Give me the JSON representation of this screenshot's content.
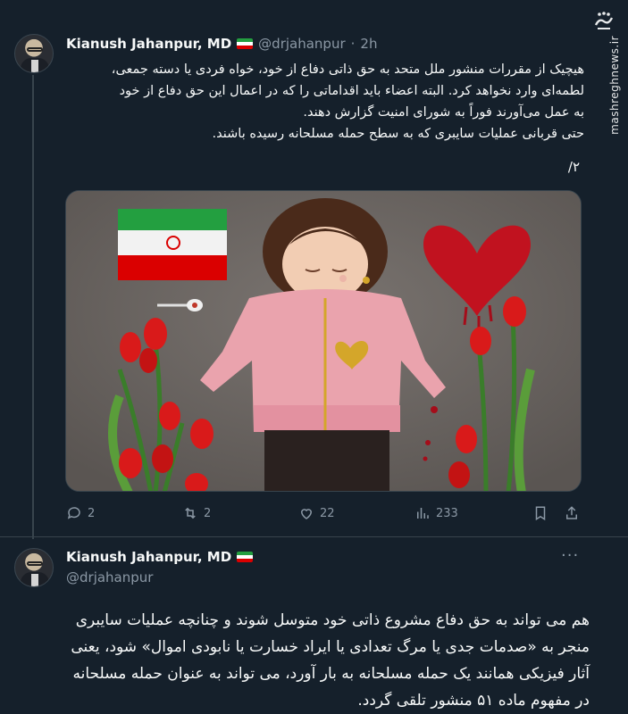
{
  "watermark": {
    "site": "mashreghnews.ir",
    "logo_name": "mashregh-logo"
  },
  "tweet1": {
    "author_name": "Kianush Jahanpur, MD",
    "handle": "@drjahanpur",
    "separator": "·",
    "time": "2h",
    "text_lines": [
      "هیچیک از مقررات منشور ملل متحد به حق ذاتی دفاع از خود، خواه فردی یا دسته جمعی،",
      "لطمه‌ای وارد نخواهد کرد. البته اعضاء باید اقداماتی را که در اعمال این حق دفاع از خود",
      "به عمل می‌آورند فوراً به شورای امنیت گزارش دهند.",
      "حتی قربانی عملیات سایبری که به سطح حمله مسلحانه رسیده باشند."
    ],
    "thread_number": "۲/",
    "stats": {
      "replies": "2",
      "reposts": "2",
      "likes": "22",
      "views": "233"
    }
  },
  "tweet2": {
    "author_name": "Kianush Jahanpur, MD",
    "handle": "@drjahanpur",
    "more_label": "···",
    "text_lines": [
      "هم می تواند به حق دفاع مشروع ذاتی خود متوسل شوند و چنانچه عملیات سایبری",
      "منجر به «صدمات جدی یا مرگ تعدادی یا ایراد خسارت یا نابودی اموال» شود، یعنی",
      "آثار فیزیکی همانند یک حمله مسلحانه به بار آورد، می تواند به عنوان حمله مسلحانه",
      "در مفهوم ماده ۵۱ منشور تلقی گردد."
    ]
  },
  "colors": {
    "background": "#15202b",
    "text": "#f7f9f9",
    "muted": "#8b98a5",
    "border": "#38444d"
  }
}
